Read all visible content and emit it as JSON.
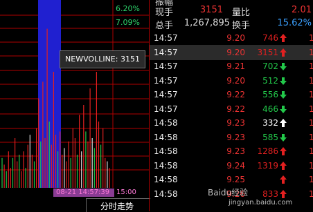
{
  "chart": {
    "pct_top": "6.20%",
    "pct_second": "7.09%",
    "tooltip": "NEWVOLLINE: 3151",
    "time_label": "08-21 14:57:39",
    "end_time": "15:00",
    "tab_label": "分时走势",
    "colors": {
      "up": "#e22020",
      "down": "#22c84a",
      "grid": "#b00000",
      "highlight": "#2020d0",
      "neutral": "#dddddd"
    },
    "bars": [
      {
        "dir": "down",
        "level": 0.18
      },
      {
        "dir": "up",
        "level": 0.14
      },
      {
        "dir": "down",
        "level": 0.1
      },
      {
        "dir": "up",
        "level": 0.22
      },
      {
        "dir": "up",
        "level": 0.12
      },
      {
        "dir": "down",
        "level": 0.18
      },
      {
        "dir": "up",
        "level": 0.3
      },
      {
        "dir": "up",
        "level": 0.16
      },
      {
        "dir": "down",
        "level": 0.2
      },
      {
        "dir": "up",
        "level": 0.1
      },
      {
        "dir": "up",
        "level": 0.22
      },
      {
        "dir": "down",
        "level": 0.12
      },
      {
        "dir": "up",
        "level": 0.26
      },
      {
        "dir": "neutral",
        "level": 0.32
      },
      {
        "dir": "up",
        "level": 0.2
      },
      {
        "dir": "down",
        "level": 0.16
      },
      {
        "dir": "up",
        "level": 0.36
      },
      {
        "dir": "up",
        "level": 0.54
      },
      {
        "dir": "down",
        "level": 0.28
      },
      {
        "dir": "up",
        "level": 0.64
      },
      {
        "dir": "up",
        "level": 0.3
      },
      {
        "dir": "up",
        "level": 0.96
      },
      {
        "dir": "down",
        "level": 0.4
      },
      {
        "dir": "up",
        "level": 0.26
      },
      {
        "dir": "up",
        "level": 0.7
      },
      {
        "dir": "up",
        "level": 0.32
      },
      {
        "dir": "down",
        "level": 0.22
      },
      {
        "dir": "up",
        "level": 0.34
      },
      {
        "dir": "up",
        "level": 0.2
      },
      {
        "dir": "neutral",
        "level": 0.24
      },
      {
        "dir": "up",
        "level": 0.16
      },
      {
        "dir": "up",
        "level": 0.28
      },
      {
        "dir": "down",
        "level": 0.18
      },
      {
        "dir": "up",
        "level": 0.36
      },
      {
        "dir": "up",
        "level": 0.3
      },
      {
        "dir": "down",
        "level": 0.2
      },
      {
        "dir": "up",
        "level": 0.44
      },
      {
        "dir": "neutral",
        "level": 0.22
      },
      {
        "dir": "up",
        "level": 0.5
      },
      {
        "dir": "down",
        "level": 0.34
      },
      {
        "dir": "up",
        "level": 0.28
      },
      {
        "dir": "up",
        "level": 0.6
      },
      {
        "dir": "neutral",
        "level": 0.3
      },
      {
        "dir": "down",
        "level": 0.24
      },
      {
        "dir": "up",
        "level": 0.7
      },
      {
        "dir": "up",
        "level": 0.4
      },
      {
        "dir": "down",
        "level": 0.26
      },
      {
        "dir": "up",
        "level": 0.36
      },
      {
        "dir": "up",
        "level": 0.18
      },
      {
        "dir": "neutral",
        "level": 0.16
      },
      {
        "dir": "up",
        "level": 0.12
      }
    ]
  },
  "summary": {
    "row0": {
      "label": "振幅",
      "label2": "",
      "value2": ""
    },
    "row1": {
      "label": "现手",
      "value": "3151",
      "label2": "量比",
      "value2": "2.01"
    },
    "row2": {
      "label": "总手",
      "value": "1,267,895",
      "label2": "换手",
      "value2": "15.62%"
    }
  },
  "trades": [
    {
      "time": "14:57",
      "price": "9.20",
      "vol": "746",
      "dir": "up",
      "n": "1"
    },
    {
      "time": "14:57",
      "price": "9.20",
      "vol": "3151",
      "dir": "up",
      "n": "1"
    },
    {
      "time": "14:57",
      "price": "9.21",
      "vol": "702",
      "dir": "down",
      "n": "1"
    },
    {
      "time": "14:57",
      "price": "9.20",
      "vol": "512",
      "dir": "down",
      "n": "1"
    },
    {
      "time": "14:57",
      "price": "9.22",
      "vol": "556",
      "dir": "down",
      "n": "1"
    },
    {
      "time": "14:57",
      "price": "9.22",
      "vol": "466",
      "dir": "down",
      "n": "1"
    },
    {
      "time": "14:58",
      "price": "9.23",
      "vol": "332",
      "dir": "neutral",
      "n": "1"
    },
    {
      "time": "14:58",
      "price": "9.23",
      "vol": "585",
      "dir": "down",
      "n": "1"
    },
    {
      "time": "14:58",
      "price": "9.23",
      "vol": "1286",
      "dir": "up",
      "n": "1"
    },
    {
      "time": "14:58",
      "price": "9.24",
      "vol": "1319",
      "dir": "up",
      "n": "1"
    },
    {
      "time": "14:58",
      "price": "9.25",
      "vol": "",
      "dir": "up",
      "n": "1"
    },
    {
      "time": "14:58",
      "price": "9.26",
      "vol": "833",
      "dir": "up",
      "n": "1"
    }
  ],
  "watermark": {
    "brand": "Baidu经验",
    "url": "jingyan.baidu.com"
  }
}
